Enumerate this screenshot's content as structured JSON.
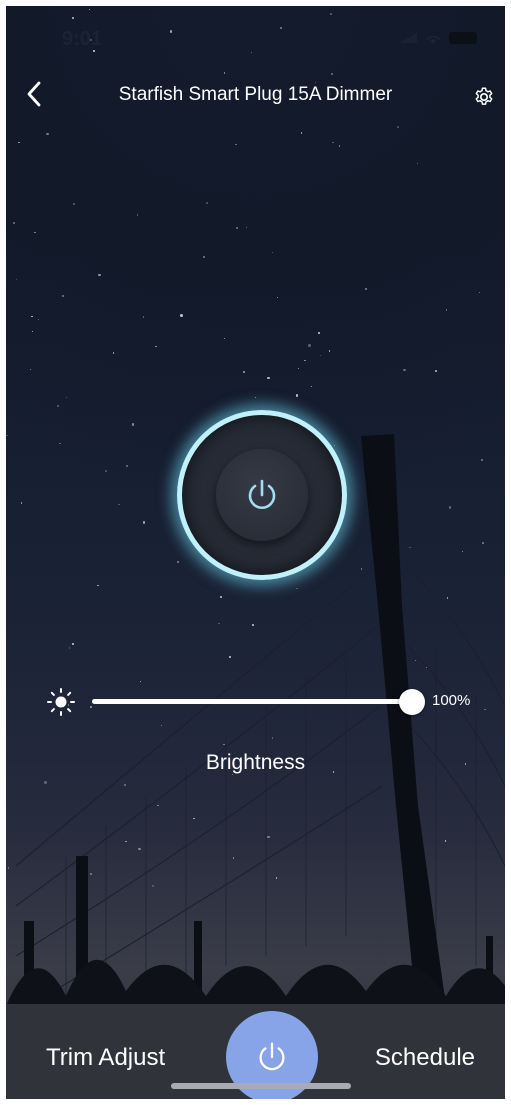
{
  "status_bar": {
    "time": "9:01",
    "icons": [
      "signal-icon",
      "wifi-icon",
      "battery-icon"
    ]
  },
  "header": {
    "title": "Starfish Smart Plug 15A Dimmer",
    "back_icon": "chevron-left-icon",
    "settings_icon": "gear-icon"
  },
  "power_dial": {
    "icon": "power-icon",
    "state": "on",
    "ring_color": "#bff1fb"
  },
  "brightness": {
    "icon": "sun-icon",
    "level": 100,
    "value_text": "100%",
    "label": "Brightness"
  },
  "bottom_bar": {
    "trim_label": "Trim Adjust",
    "schedule_label": "Schedule",
    "power_icon": "power-icon",
    "power_button_color": "#88a4e8"
  }
}
